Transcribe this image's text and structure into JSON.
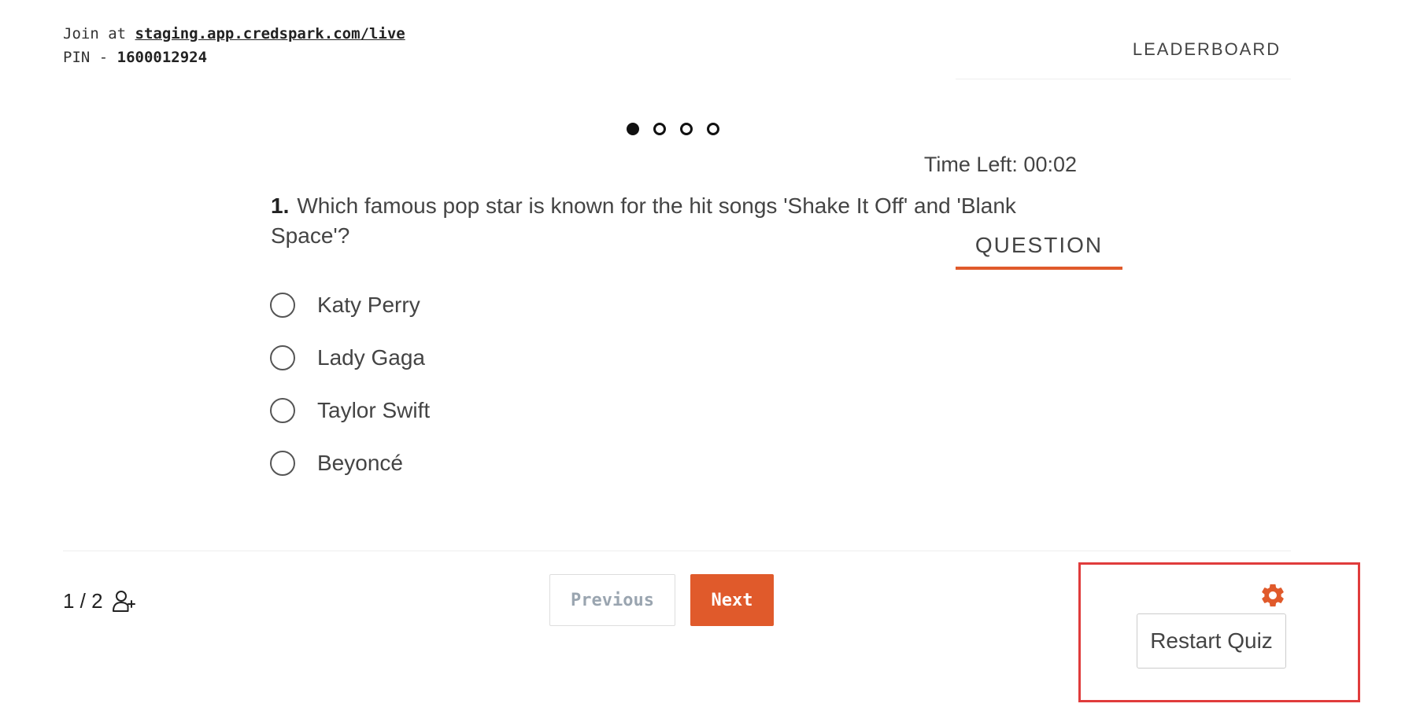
{
  "join": {
    "prefix": "Join at",
    "url": "staging.app.credspark.com/live",
    "pin_label": "PIN -",
    "pin_value": "1600012924"
  },
  "tabs": [
    {
      "label": "QUESTION",
      "active": true
    },
    {
      "label": "LEADERBOARD",
      "active": false
    }
  ],
  "progress": {
    "total": 4,
    "current": 1
  },
  "timer": {
    "text": "Time Left: 00:02"
  },
  "question": {
    "number": "1.",
    "text": "Which famous pop star is known for the hit songs 'Shake It Off' and 'Blank Space'?",
    "options": [
      "Katy Perry",
      "Lady Gaga",
      "Taylor Swift",
      "Beyoncé"
    ]
  },
  "footer": {
    "participants": "1 / 2",
    "participants_icon": "add-user-icon",
    "previous_label": "Previous",
    "next_label": "Next",
    "restart_label": "Restart Quiz",
    "settings_icon": "gear-icon"
  },
  "colors": {
    "accent": "#e05a2b",
    "highlight_border": "#e03c3c"
  }
}
